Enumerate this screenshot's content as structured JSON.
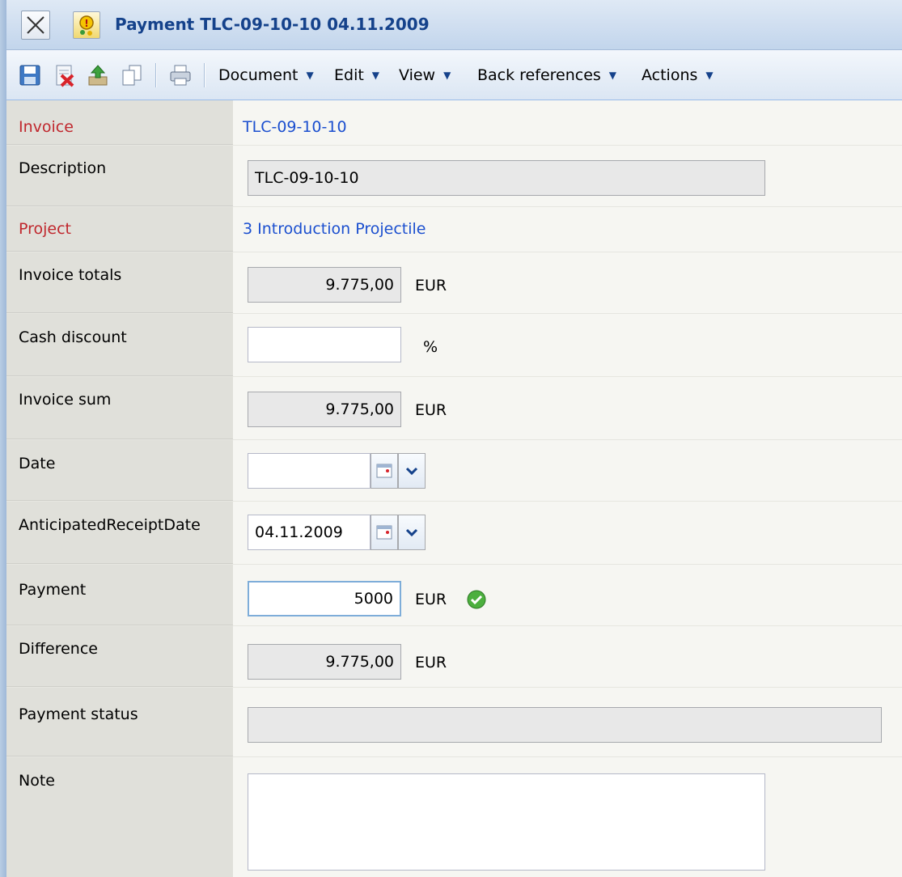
{
  "window": {
    "title": "Payment TLC-09-10-10 04.11.2009",
    "colors": {
      "title_text": "#15428b",
      "link": "#1b4fcf",
      "required_label": "#c0272d",
      "label_bg": "#e0e0da"
    }
  },
  "toolbar": {
    "icons": [
      "save-icon",
      "delete-icon",
      "upload-icon",
      "copy-icon",
      "print-icon"
    ],
    "menus": [
      {
        "label": "Document"
      },
      {
        "label": "Edit"
      },
      {
        "label": "View"
      },
      {
        "label": "Back references"
      },
      {
        "label": "Actions"
      }
    ]
  },
  "form": {
    "invoice": {
      "label": "Invoice",
      "value": "TLC-09-10-10"
    },
    "description": {
      "label": "Description",
      "value": "TLC-09-10-10"
    },
    "project": {
      "label": "Project",
      "value": "3 Introduction Projectile"
    },
    "invoice_totals": {
      "label": "Invoice totals",
      "value": "9.775,00",
      "unit": "EUR"
    },
    "cash_discount": {
      "label": "Cash discount",
      "value": "",
      "unit": "%"
    },
    "invoice_sum": {
      "label": "Invoice sum",
      "value": "9.775,00",
      "unit": "EUR"
    },
    "date": {
      "label": "Date",
      "value": ""
    },
    "anticipated_receipt_date": {
      "label": "AnticipatedReceiptDate",
      "value": "04.11.2009"
    },
    "payment": {
      "label": "Payment",
      "value": "5000",
      "unit": "EUR"
    },
    "difference": {
      "label": "Difference",
      "value": "9.775,00",
      "unit": "EUR"
    },
    "payment_status": {
      "label": "Payment status",
      "value": ""
    },
    "note": {
      "label": "Note",
      "value": ""
    }
  }
}
